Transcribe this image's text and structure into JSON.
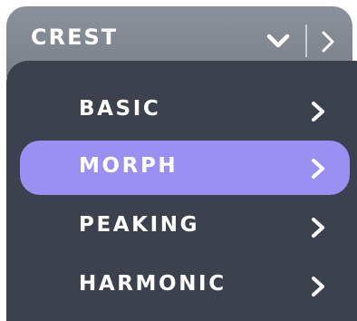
{
  "dropdown": {
    "selected_label": "CREST",
    "expand_icon": "chevron-down-icon",
    "next_icon": "chevron-right-icon"
  },
  "menu": {
    "items": [
      {
        "label": "BASIC",
        "selected": false,
        "icon": "chevron-right-icon"
      },
      {
        "label": "MORPH",
        "selected": true,
        "icon": "chevron-right-icon"
      },
      {
        "label": "PEAKING",
        "selected": false,
        "icon": "chevron-right-icon"
      },
      {
        "label": "HARMONIC",
        "selected": false,
        "icon": "chevron-right-icon"
      }
    ]
  },
  "colors": {
    "header_background": "#838a94",
    "menu_background": "#3b414d",
    "selected_item_background": "#9a8ff3",
    "text": "#ffffff"
  }
}
